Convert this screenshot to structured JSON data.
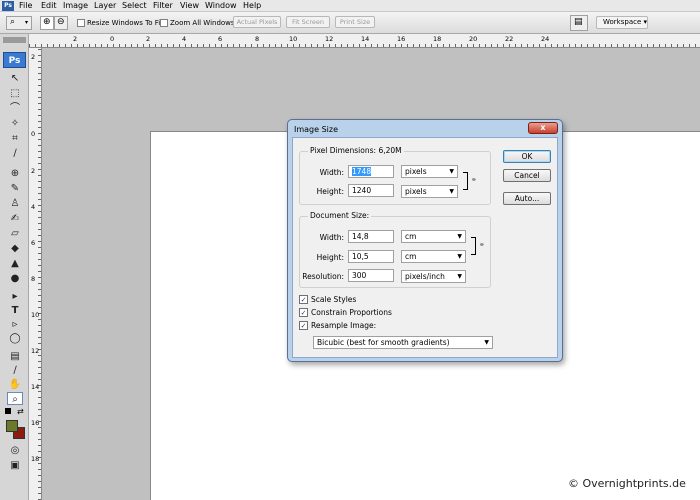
{
  "menu": [
    "File",
    "Edit",
    "Image",
    "Layer",
    "Select",
    "Filter",
    "View",
    "Window",
    "Help"
  ],
  "app_logo": "Ps",
  "options": {
    "resize_windows": "Resize Windows To Fit",
    "zoom_all": "Zoom All Windows",
    "actual_pixels": "Actual Pixels",
    "fit_screen": "Fit Screen",
    "print_size": "Print Size",
    "workspace": "Workspace ▾"
  },
  "ruler_top": [
    "2",
    "0",
    "2",
    "4",
    "6",
    "8",
    "10",
    "12",
    "14",
    "16",
    "18",
    "20",
    "22",
    "24"
  ],
  "ruler_left": [
    "2",
    "0",
    "2",
    "4",
    "6",
    "8",
    "10",
    "12",
    "14",
    "16",
    "18"
  ],
  "dialog": {
    "title": "Image Size",
    "close": "x",
    "pixel_dimensions_label": "Pixel Dimensions:",
    "pixel_dimensions_value": "6,20M",
    "width_label": "Width:",
    "height_label": "Height:",
    "pixel_width": "1748",
    "pixel_height": "1240",
    "pixel_unit": "pixels",
    "document_size_label": "Document Size:",
    "doc_width": "14,8",
    "doc_height": "10,5",
    "doc_unit": "cm",
    "resolution_label": "Resolution:",
    "resolution": "300",
    "resolution_unit": "pixels/inch",
    "scale_styles": "Scale Styles",
    "constrain": "Constrain Proportions",
    "resample": "Resample Image:",
    "resample_method": "Bicubic (best for smooth gradients)",
    "ok": "OK",
    "cancel": "Cancel",
    "auto": "Auto..."
  },
  "watermark": "© Overnightprints.de"
}
